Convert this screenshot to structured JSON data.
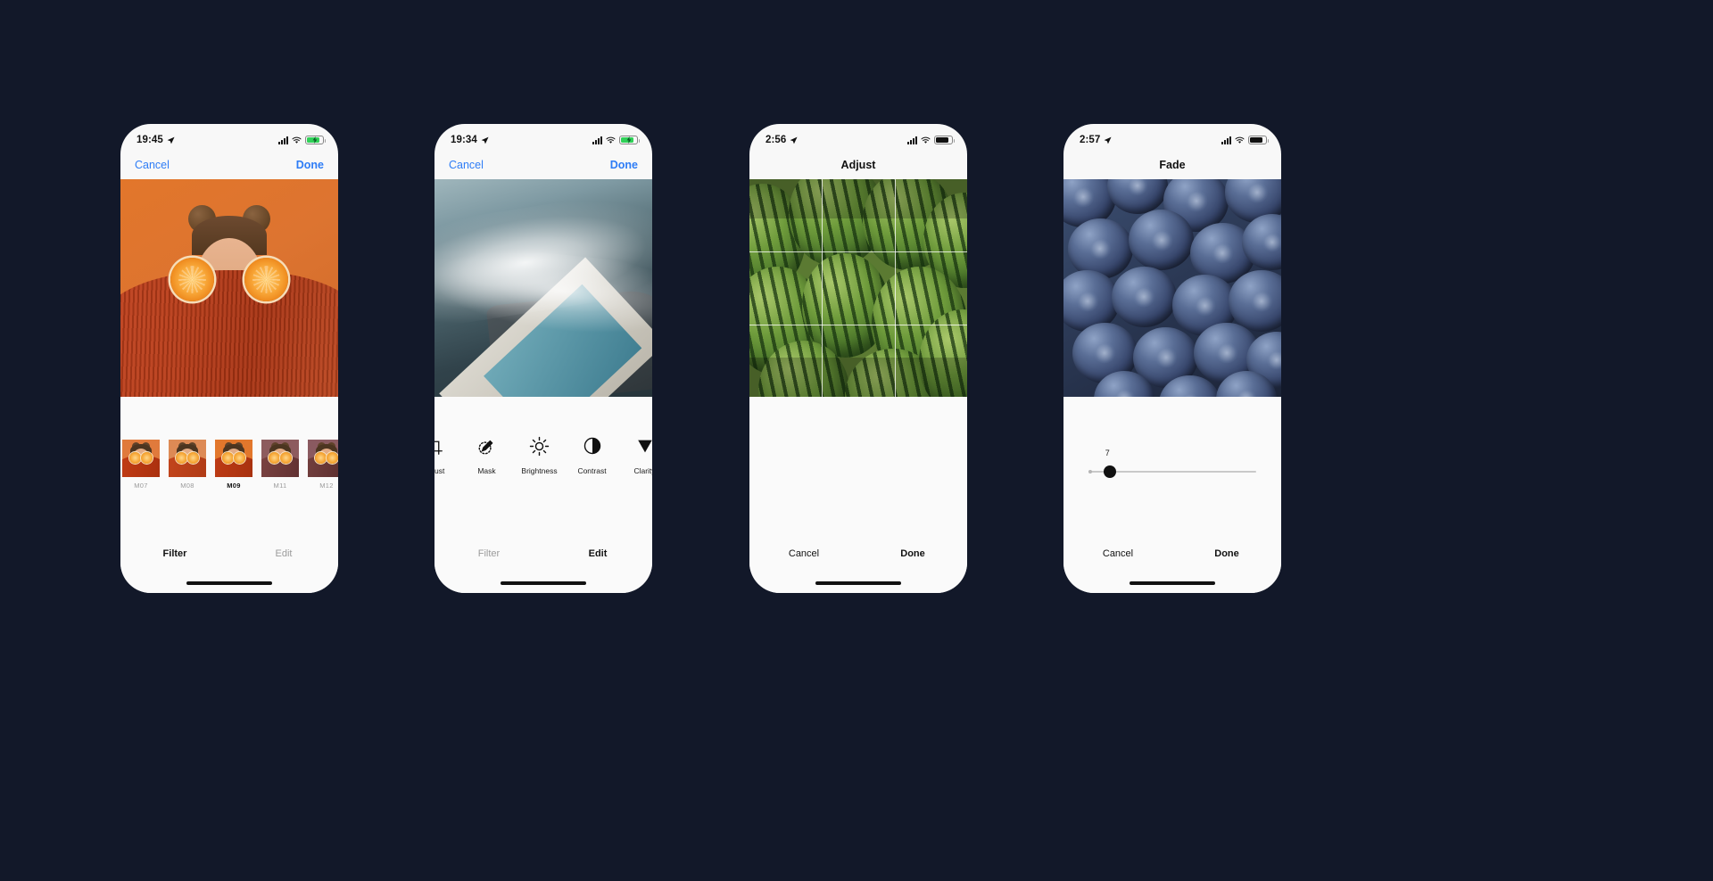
{
  "app": {
    "background_color": "#121829",
    "accent_color": "#2e7df6"
  },
  "phones": [
    {
      "id": "filter-screen",
      "status": {
        "time": "19:45",
        "location_icon": "location-arrow-icon",
        "battery_style": "charging-green"
      },
      "nav": {
        "left_label": "Cancel",
        "right_label": "Done",
        "title": ""
      },
      "photo": "portrait-oranges",
      "filters": [
        {
          "label": "M07",
          "selected": false
        },
        {
          "label": "M08",
          "selected": false
        },
        {
          "label": "M09",
          "selected": true
        },
        {
          "label": "M11",
          "selected": false
        },
        {
          "label": "M12",
          "selected": false
        }
      ],
      "bottom": [
        {
          "label": "Filter",
          "state": "active"
        },
        {
          "label": "Edit",
          "state": "inactive"
        }
      ]
    },
    {
      "id": "edit-screen",
      "status": {
        "time": "19:34",
        "location_icon": "location-arrow-icon",
        "battery_style": "charging-green"
      },
      "nav": {
        "left_label": "Cancel",
        "right_label": "Done",
        "title": ""
      },
      "photo": "ocean-pool-aerial",
      "tools": [
        {
          "label": "Adjust",
          "icon": "crop-icon"
        },
        {
          "label": "Mask",
          "icon": "brush-mask-icon"
        },
        {
          "label": "Brightness",
          "icon": "sun-icon"
        },
        {
          "label": "Contrast",
          "icon": "contrast-circle-icon"
        },
        {
          "label": "Clarity",
          "icon": "triangle-clarity-icon"
        }
      ],
      "bottom": [
        {
          "label": "Filter",
          "state": "inactive"
        },
        {
          "label": "Edit",
          "state": "active"
        }
      ]
    },
    {
      "id": "adjust-screen",
      "status": {
        "time": "2:56",
        "location_icon": "location-arrow-icon",
        "battery_style": "dark"
      },
      "nav": {
        "left_label": "",
        "right_label": "",
        "title": "Adjust"
      },
      "photo": "watermelons",
      "crop_overlay": {
        "grid": "rule-of-thirds",
        "visible": true
      },
      "bottom": [
        {
          "label": "Cancel",
          "state": "plain"
        },
        {
          "label": "Done",
          "state": "plain-strong"
        }
      ]
    },
    {
      "id": "fade-screen",
      "status": {
        "time": "2:57",
        "location_icon": "location-arrow-icon",
        "battery_style": "dark"
      },
      "nav": {
        "left_label": "",
        "right_label": "",
        "title": "Fade"
      },
      "photo": "blueberries",
      "slider": {
        "value": "7",
        "min": 0,
        "max": 100,
        "percent": 12
      },
      "bottom": [
        {
          "label": "Cancel",
          "state": "plain"
        },
        {
          "label": "Done",
          "state": "plain-strong"
        }
      ]
    }
  ]
}
